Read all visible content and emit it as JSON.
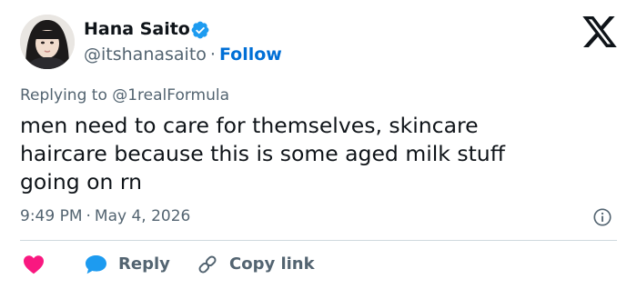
{
  "author": {
    "name": "Hana Saito",
    "handle": "@itshanasaito",
    "separator": "·",
    "follow_label": "Follow",
    "verified_color": "#1d9bf0"
  },
  "reply_context": "Replying to @1realFormula",
  "body_lines": [
    "men need to care for themselves, skincare",
    "haircare because this is some aged milk stuff",
    "going on rn"
  ],
  "timestamp": {
    "time": "9:49 PM",
    "separator": "·",
    "date": "May 4, 2026"
  },
  "actions": {
    "reply_label": "Reply",
    "copy_link_label": "Copy link"
  },
  "icons": {
    "brand": "x-logo-icon",
    "verified": "verified-badge-icon",
    "info": "info-icon",
    "like": "heart-icon",
    "reply": "speech-bubble-icon",
    "copy": "link-icon"
  },
  "colors": {
    "text": "#0f1419",
    "secondary": "#536471",
    "link": "#006fd6",
    "like": "#f91880",
    "reply": "#1d9bf0",
    "divider": "#cfd9de"
  }
}
